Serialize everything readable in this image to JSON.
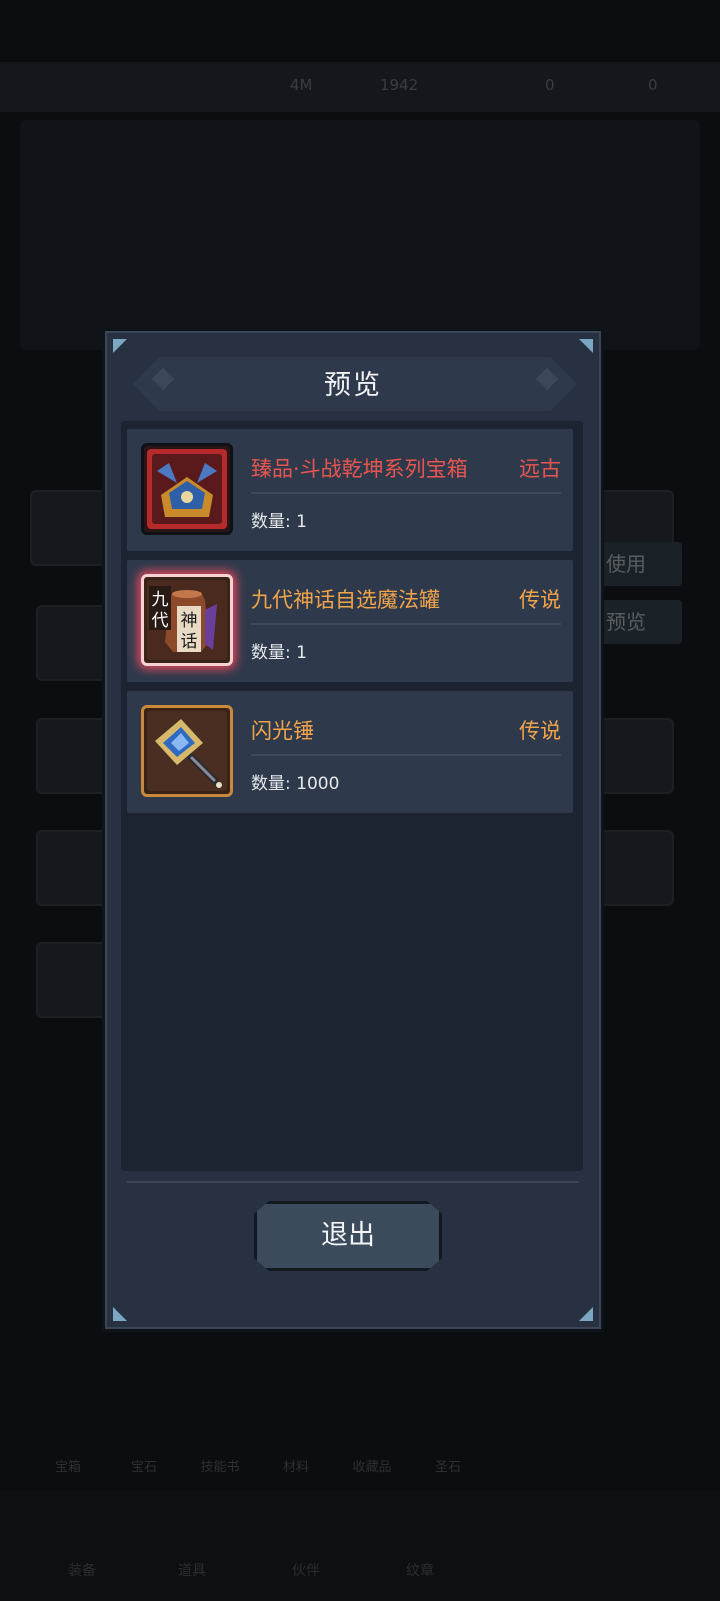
{
  "dialog": {
    "title": "预览",
    "exit_label": "退出"
  },
  "items": [
    {
      "name": "臻品·斗战乾坤系列宝箱",
      "rarity": "远古",
      "quantity": "数量: 1",
      "name_color": "#e8554e",
      "rarity_color": "#e8554e",
      "icon": "treasure-chest-icon"
    },
    {
      "name": "九代神话自选魔法罐",
      "rarity": "传说",
      "quantity": "数量: 1",
      "name_color": "#f2a44a",
      "rarity_color": "#f2a44a",
      "icon": "magic-jar-icon",
      "icon_text": [
        "九",
        "代",
        "神",
        "话"
      ]
    },
    {
      "name": "闪光锤",
      "rarity": "传说",
      "quantity": "数量: 1000",
      "name_color": "#f2a44a",
      "rarity_color": "#f2a44a",
      "icon": "hammer-icon"
    }
  ],
  "background": {
    "top_values": [
      "4M",
      "1942",
      "0",
      "0"
    ],
    "side_buttons": [
      "使用",
      "预览"
    ],
    "tabs": [
      "宝箱",
      "宝石",
      "技能书",
      "材料",
      "收藏品",
      "圣石"
    ],
    "nav": [
      "装备",
      "道具",
      "伙伴",
      "纹章"
    ]
  }
}
